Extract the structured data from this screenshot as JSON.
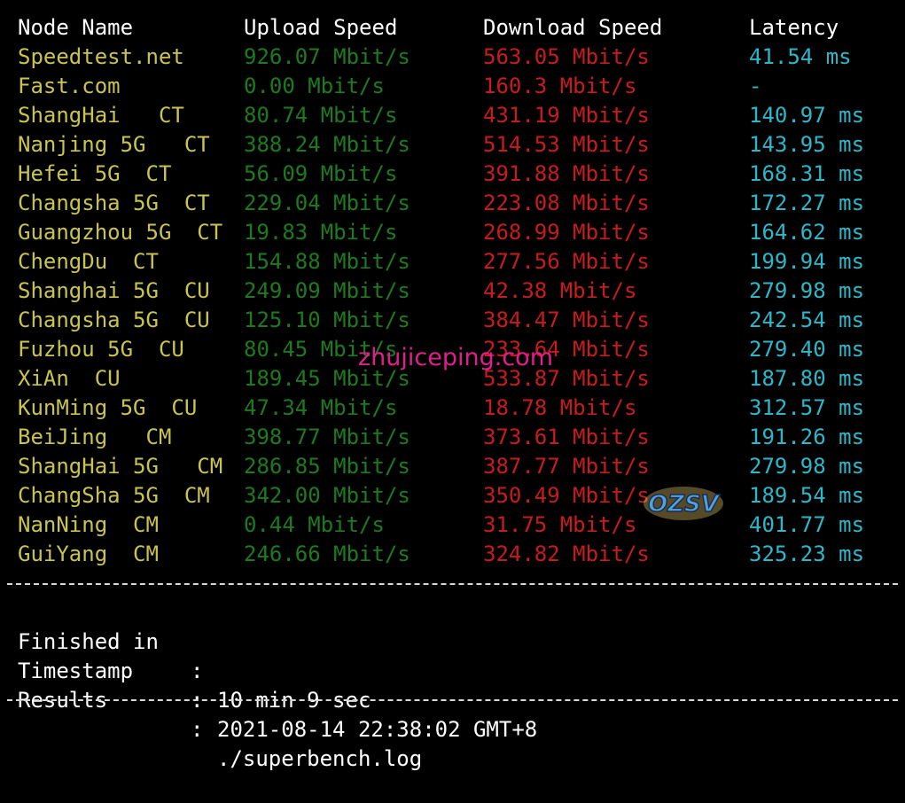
{
  "header": {
    "node_name": "Node Name",
    "upload": "Upload Speed",
    "download": "Download Speed",
    "latency": "Latency"
  },
  "rows": [
    {
      "node": "Speedtest.net",
      "up": "926.07 Mbit/s",
      "down": "563.05 Mbit/s",
      "lat": "41.54 ms"
    },
    {
      "node": "Fast.com",
      "up": "0.00 Mbit/s",
      "down": "160.3 Mbit/s",
      "lat": "-"
    },
    {
      "node": "ShangHai   CT",
      "up": "80.74 Mbit/s",
      "down": "431.19 Mbit/s",
      "lat": "140.97 ms"
    },
    {
      "node": "Nanjing 5G   CT",
      "up": "388.24 Mbit/s",
      "down": "514.53 Mbit/s",
      "lat": "143.95 ms"
    },
    {
      "node": "Hefei 5G  CT",
      "up": "56.09 Mbit/s",
      "down": "391.88 Mbit/s",
      "lat": "168.31 ms"
    },
    {
      "node": "Changsha 5G  CT",
      "up": "229.04 Mbit/s",
      "down": "223.08 Mbit/s",
      "lat": "172.27 ms"
    },
    {
      "node": "Guangzhou 5G  CT",
      "up": "19.83 Mbit/s",
      "down": "268.99 Mbit/s",
      "lat": "164.62 ms"
    },
    {
      "node": "ChengDu  CT",
      "up": "154.88 Mbit/s",
      "down": "277.56 Mbit/s",
      "lat": "199.94 ms"
    },
    {
      "node": "Shanghai 5G  CU",
      "up": "249.09 Mbit/s",
      "down": "42.38 Mbit/s",
      "lat": "279.98 ms"
    },
    {
      "node": "Changsha 5G  CU",
      "up": "125.10 Mbit/s",
      "down": "384.47 Mbit/s",
      "lat": "242.54 ms"
    },
    {
      "node": "Fuzhou 5G  CU",
      "up": "80.45 Mbit/s",
      "down": "233.64 Mbit/s",
      "lat": "279.40 ms"
    },
    {
      "node": "XiAn  CU",
      "up": "189.45 Mbit/s",
      "down": "533.87 Mbit/s",
      "lat": "187.80 ms"
    },
    {
      "node": "KunMing 5G  CU",
      "up": "47.34 Mbit/s",
      "down": "18.78 Mbit/s",
      "lat": "312.57 ms"
    },
    {
      "node": "BeiJing   CM",
      "up": "398.77 Mbit/s",
      "down": "373.61 Mbit/s",
      "lat": "191.26 ms"
    },
    {
      "node": "ShangHai 5G   CM",
      "up": "286.85 Mbit/s",
      "down": "387.77 Mbit/s",
      "lat": "279.98 ms"
    },
    {
      "node": "ChangSha 5G  CM",
      "up": "342.00 Mbit/s",
      "down": "350.49 Mbit/s",
      "lat": "189.54 ms"
    },
    {
      "node": "NanNing  CM",
      "up": "0.44 Mbit/s",
      "down": "31.75 Mbit/s",
      "lat": "401.77 ms"
    },
    {
      "node": "GuiYang  CM",
      "up": "246.66 Mbit/s",
      "down": "324.82 Mbit/s",
      "lat": "325.23 ms"
    }
  ],
  "summary": {
    "finished_label": "Finished in",
    "finished_value": "10 min 9 sec",
    "timestamp_label": "Timestamp",
    "timestamp_value": "2021-08-14 22:38:02 GMT+8",
    "results_label": "Results",
    "results_value": "./superbench.log",
    "colon": ":"
  },
  "watermark": {
    "text": "zhujiceping.com"
  },
  "logo": {
    "text": "OZSV"
  },
  "colors": {
    "background": "#000000",
    "node": "#c9c44f",
    "upload": "#1e7a1e",
    "download": "#c81c1c",
    "latency": "#2cb8c8",
    "watermark": "#e0208a"
  }
}
